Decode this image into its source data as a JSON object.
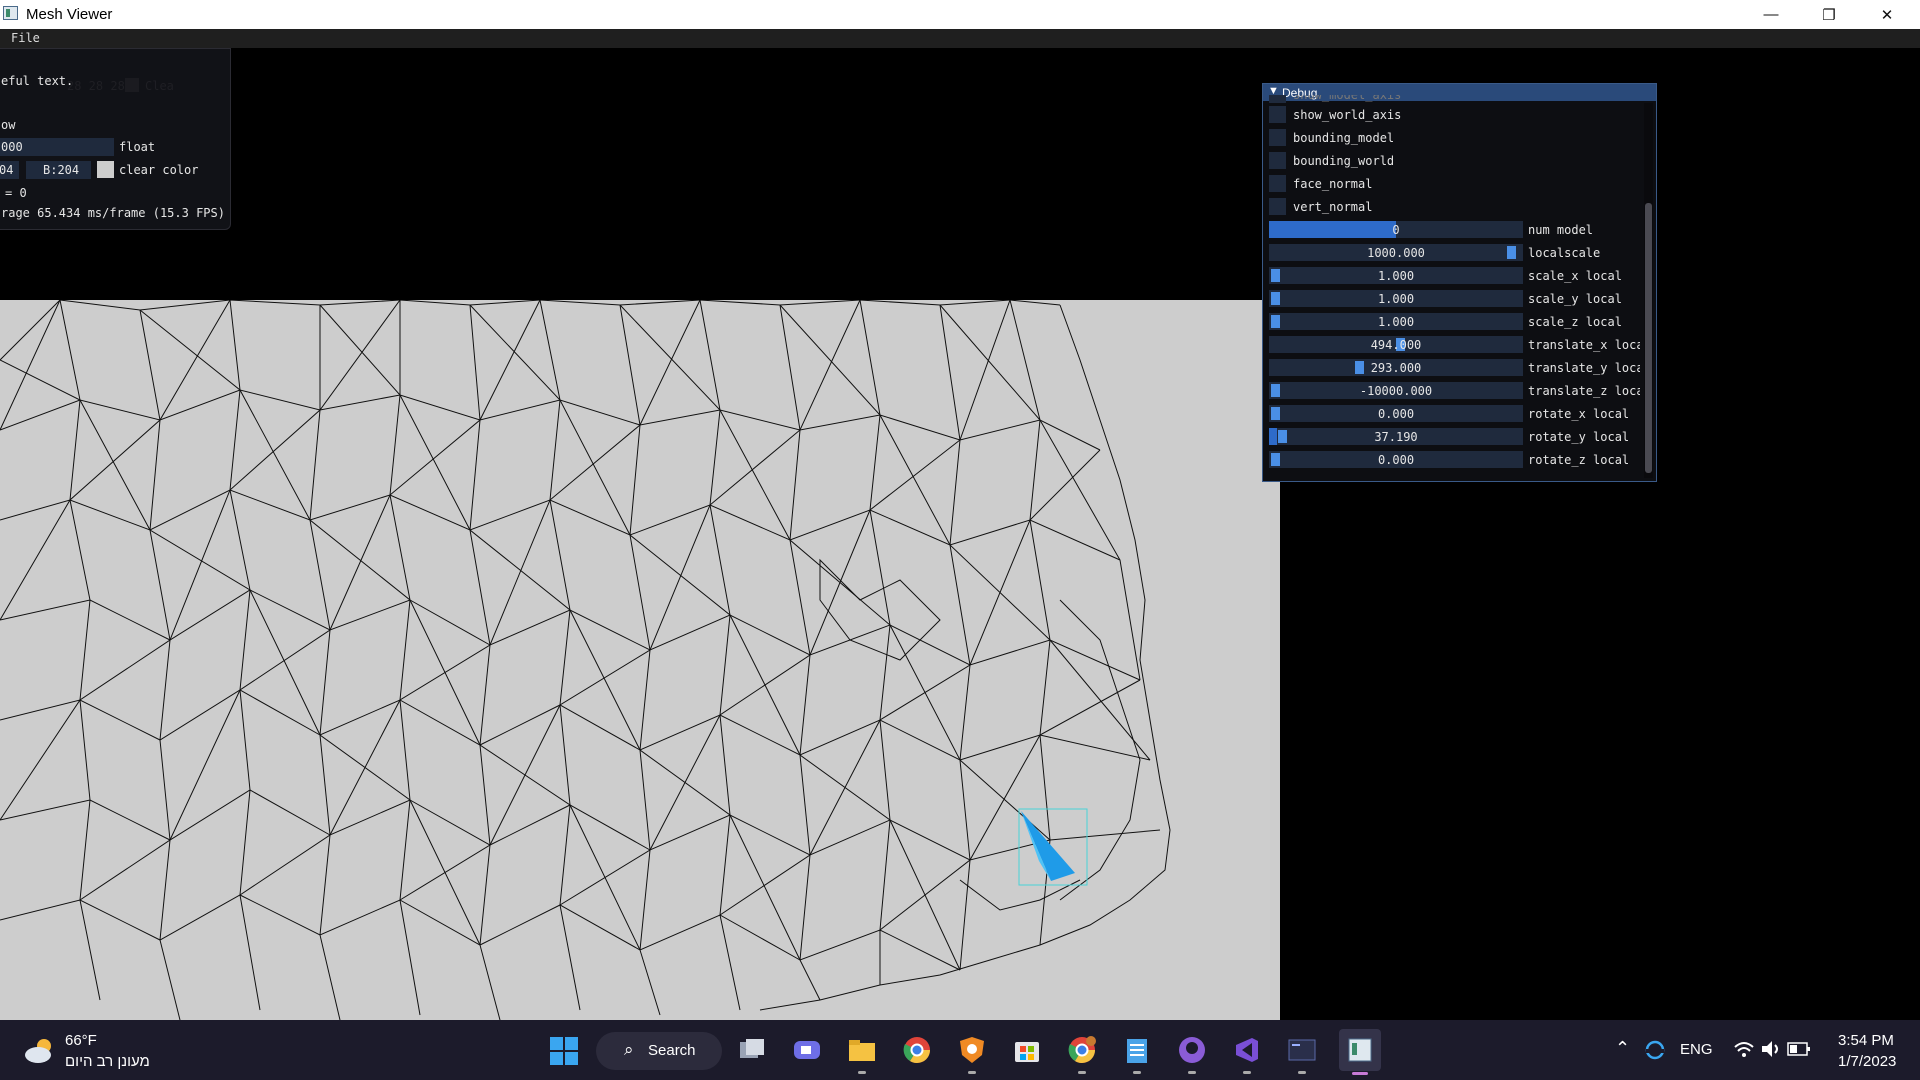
{
  "window": {
    "title": "Mesh Viewer",
    "minimize": "—",
    "maximize": "❐",
    "close": "✕"
  },
  "menu": {
    "file": "File"
  },
  "small_panel": {
    "text_line": "eful text.",
    "faded_line": "28 28 28",
    "faded_clear": "Clea",
    "window_line": "ow",
    "float_value": "000",
    "float_label": "float",
    "color_b_prefix": "04",
    "color_b": "B:204",
    "clear_color_label": "clear color",
    "counter": "= 0",
    "fps": "rage 65.434 ms/frame (15.3 FPS)"
  },
  "debug": {
    "title": "Debug",
    "arrow": "▼",
    "cut_label": "show_model_axis",
    "checkboxes": [
      "show_world_axis",
      "bounding_model",
      "bounding_world",
      "face_normal",
      "vert_normal"
    ],
    "sliders": [
      {
        "value": "0",
        "label": "num model",
        "level": 0.5
      },
      {
        "value": "1000.000",
        "label": "localscale",
        "level": 0.98
      },
      {
        "value": "1.000",
        "label": "scale_x local",
        "level": 0.0
      },
      {
        "value": "1.000",
        "label": "scale_y local",
        "level": 0.0
      },
      {
        "value": "1.000",
        "label": "scale_z local",
        "level": 0.0
      },
      {
        "value": "494.000",
        "label": "translate_x local",
        "level": 0.52
      },
      {
        "value": "293.000",
        "label": "translate_y local",
        "level": 0.35
      },
      {
        "value": "-10000.000",
        "label": "translate_z local",
        "level": 0.0
      },
      {
        "value": "0.000",
        "label": "rotate_x local",
        "level": 0.0
      },
      {
        "value": "37.190",
        "label": "rotate_y local",
        "level": 0.03
      },
      {
        "value": "0.000",
        "label": "rotate_z local",
        "level": 0.0
      }
    ]
  },
  "taskbar": {
    "weather_temp": "66°F",
    "weather_desc": "מעונן רב היום",
    "search": "Search",
    "lang": "ENG",
    "time": "3:54 PM",
    "date": "1/7/2023"
  }
}
